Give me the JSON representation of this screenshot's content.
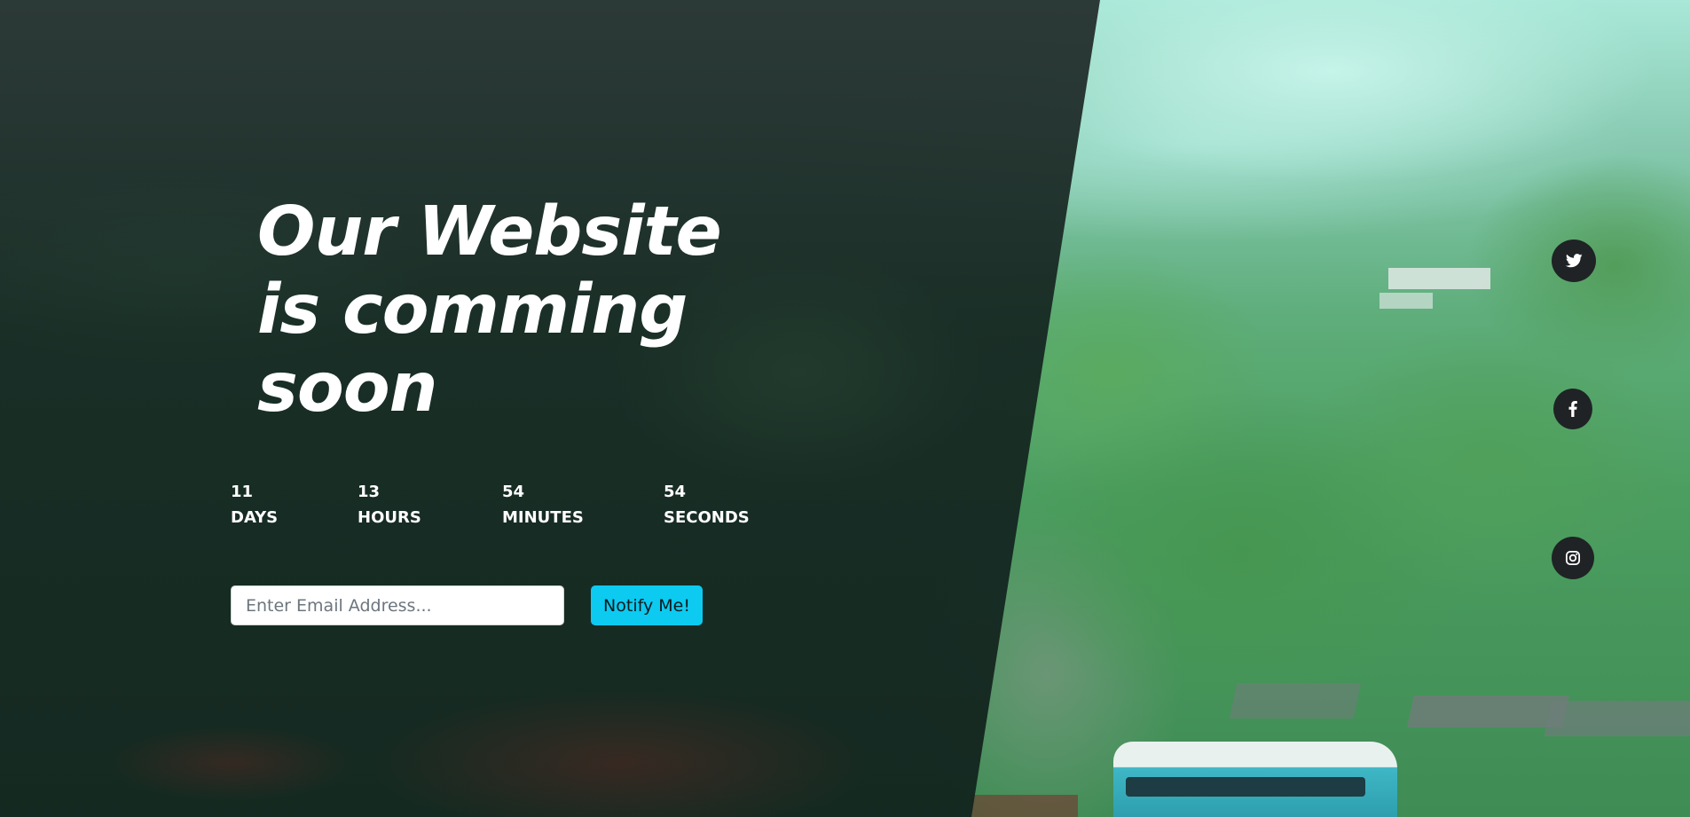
{
  "hero": {
    "headline_line1": "Our Website",
    "headline_line2": "is comming",
    "headline_line3": "soon"
  },
  "countdown": [
    {
      "value": "11",
      "label": "DAYS"
    },
    {
      "value": "13",
      "label": "HOURS"
    },
    {
      "value": "54",
      "label": "MINUTES"
    },
    {
      "value": "54",
      "label": "SECONDS"
    }
  ],
  "subscribe": {
    "email_placeholder": "Enter Email Address...",
    "email_value": "",
    "button_label": "Notify Me!"
  },
  "social": [
    {
      "icon": "twitter-icon"
    },
    {
      "icon": "facebook-icon"
    },
    {
      "icon": "instagram-icon"
    }
  ],
  "colors": {
    "panel": "#1c2e29",
    "button_accent": "#0dcaf0",
    "social_bg": "#1f2325",
    "text": "#ffffff"
  }
}
